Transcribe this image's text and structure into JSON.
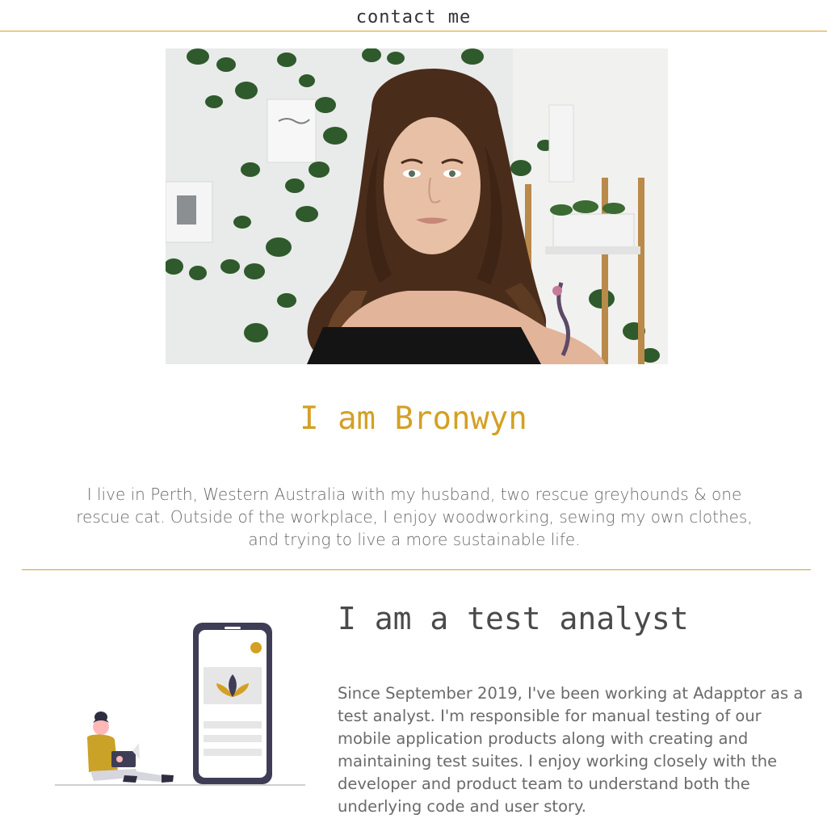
{
  "nav": {
    "contact_label": "contact me"
  },
  "intro": {
    "title": "I am Bronwyn",
    "text": "I live in Perth, Western Australia with my husband, two rescue greyhounds & one rescue cat. Outside of the workplace, I enjoy woodworking, sewing my own clothes, and trying to live a more sustainable life."
  },
  "work": {
    "title": "I am a test analyst",
    "text": "Since September 2019, I've been working at Adapptor as a test analyst. I'm responsible for manual testing of our mobile application products along with creating and maintaining test suites. I enjoy working closely with the developer and product team to understand both the underlying code and user story."
  },
  "colors": {
    "accent": "#d4a024",
    "text": "#6a6a6a",
    "heading": "#4a4a4a",
    "phone_frame": "#3f3d56"
  },
  "icons": {
    "portrait": "portrait-photo",
    "illustration": "phone-user-illustration"
  }
}
